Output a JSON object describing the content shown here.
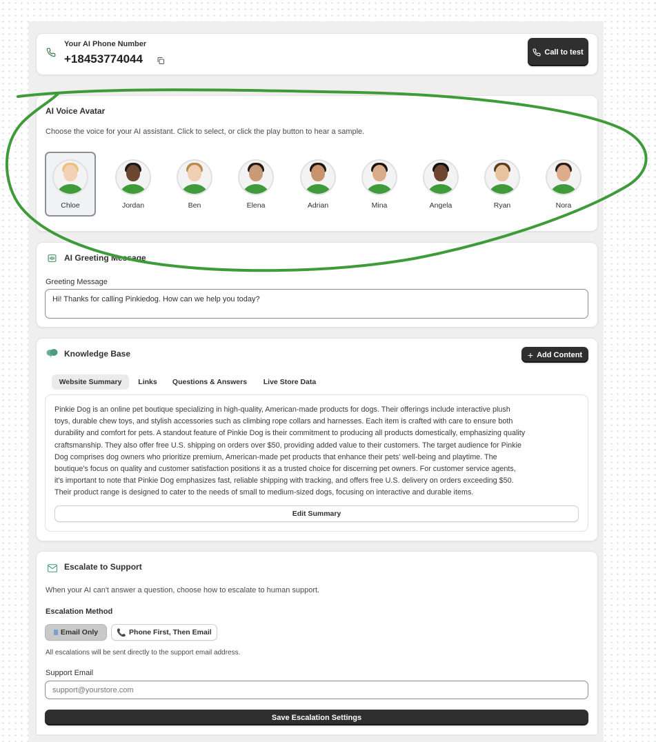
{
  "phone": {
    "label": "Your AI Phone Number",
    "number": "+18453774044",
    "call_button": "Call to test"
  },
  "voice": {
    "title": "AI Voice Avatar",
    "description": "Choose the voice for your AI assistant. Click to select, or click the play button to hear a sample.",
    "selected": "Chloe",
    "avatars": [
      {
        "name": "Chloe"
      },
      {
        "name": "Jordan"
      },
      {
        "name": "Ben"
      },
      {
        "name": "Elena"
      },
      {
        "name": "Adrian"
      },
      {
        "name": "Mina"
      },
      {
        "name": "Angela"
      },
      {
        "name": "Ryan"
      },
      {
        "name": "Nora"
      }
    ]
  },
  "greeting": {
    "title": "AI Greeting Message",
    "field_label": "Greeting Message",
    "value": "Hi! Thanks for calling Pinkiedog. How can we help you today?"
  },
  "knowledge": {
    "title": "Knowledge Base",
    "add_button": "Add Content",
    "tabs": [
      {
        "label": "Website Summary",
        "active": true
      },
      {
        "label": "Links",
        "active": false
      },
      {
        "label": "Questions & Answers",
        "active": false
      },
      {
        "label": "Live Store Data",
        "active": false
      }
    ],
    "summary_lines": [
      "Pinkie Dog is an online pet boutique specializing in high-quality, American-made products for dogs. Their offerings include interactive plush",
      "toys, durable chew toys, and stylish accessories such as climbing rope collars and harnesses. Each item is crafted with care to ensure both",
      "durability and comfort for pets. A standout feature of Pinkie Dog is their commitment to producing all products domestically, emphasizing quality",
      "craftsmanship. They also offer free U.S. shipping on orders over $50, providing added value to their customers. The target audience for Pinkie",
      "Dog comprises dog owners who prioritize premium, American-made pet products that enhance their pets' well-being and playtime. The",
      "boutique's focus on quality and customer satisfaction positions it as a trusted choice for discerning pet owners. For customer service agents,",
      "it's important to note that Pinkie Dog emphasizes fast, reliable shipping with tracking, and offers free U.S. delivery on orders exceeding $50.",
      "Their product range is designed to cater to the needs of small to medium-sized dogs, focusing on interactive and durable items."
    ],
    "edit_button": "Edit Summary"
  },
  "escalation": {
    "title": "Escalate to Support",
    "description": "When your AI can't answer a question, choose how to escalate to human support.",
    "method_label": "Escalation Method",
    "options": [
      {
        "label": "Email Only",
        "active": true
      },
      {
        "label": "Phone First, Then Email",
        "active": false
      }
    ],
    "note": "All escalations will be sent directly to the support email address.",
    "email_label": "Support Email",
    "email_placeholder": "support@yourstore.com",
    "save_button": "Save Escalation Settings"
  },
  "colors": {
    "annotation_stroke": "#3f9b3a",
    "primary_button": "#2f2f2f",
    "shirt": "#3f9b3a"
  }
}
